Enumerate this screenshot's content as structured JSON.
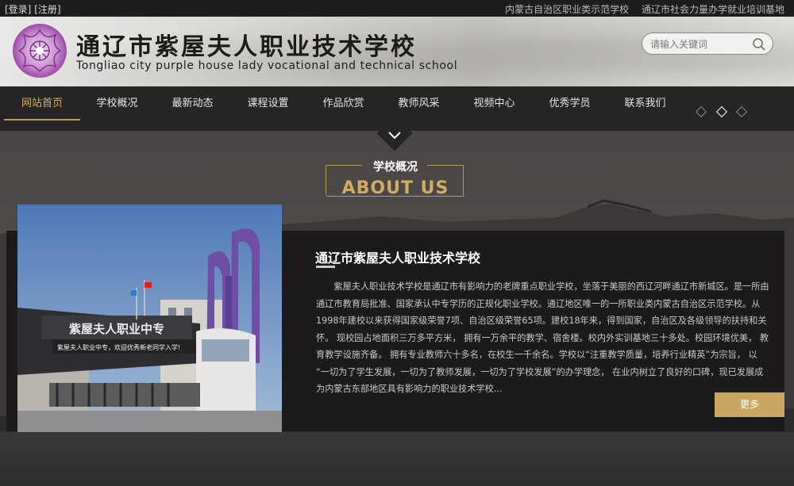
{
  "topbar": {
    "login": "[登录]",
    "register": "[注册]",
    "link1": "内蒙古自治区职业类示范学校",
    "link2": "通辽市社会力量办学就业培训基地"
  },
  "header": {
    "title_cn": "通辽市紫屋夫人职业技术学校",
    "title_en": "Tongliao city purple house lady vocational and technical school",
    "search_placeholder": "请输入关键词"
  },
  "nav": {
    "items": [
      {
        "label": "网站首页",
        "active": true
      },
      {
        "label": "学校概况"
      },
      {
        "label": "最新动态"
      },
      {
        "label": "课程设置"
      },
      {
        "label": "作品欣赏"
      },
      {
        "label": "教师风采"
      },
      {
        "label": "视频中心"
      },
      {
        "label": "优秀学员"
      },
      {
        "label": "联系我们"
      }
    ],
    "slides": 3,
    "active_slide": 2
  },
  "about": {
    "title_cn": "学校概况",
    "title_en": "ABOUT US",
    "school_name": "通辽市紫屋夫人职业技术学校",
    "description": "紫屋夫人职业技术学校是通辽市有影响力的老牌重点职业学校，坐落于美丽的西辽河畔通辽市新城区。是一所由通辽市教育局批准、国家承认中专学历的正规化职业学校。通辽地区唯一的一所职业类内蒙古自治区示范学校。从1998年建校以来获得国家级荣誉7项、自治区级荣誉65项。建校18年来，得到国家，自治区及各级领导的扶持和关怀。 现校园占地面积三万多平方米， 拥有一万余平的教学、宿舍楼。校内外实训基地三十多处。校园环境优美， 教育教学设施齐备。 拥有专业教师六十多名，在校生一千余名。学校以“注重教学质量，培养行业精英”为宗旨， 以 “一切为了学生发展，一切为了教师发展，一切为了学校发展”的办学理念， 在业内树立了良好的口碑，现已发展成为内蒙古东部地区具有影响力的职业技术学校...",
    "more_label": "更多",
    "photo": {
      "sign_text": "紫屋夫人职业中专",
      "banner_text": "紫屋夫人职业中专，欢迎优秀新老同学入学!"
    }
  },
  "colors": {
    "accent_gold": "#c9a760",
    "nav_bg": "#262424",
    "header_bg": "#dcdad6"
  }
}
